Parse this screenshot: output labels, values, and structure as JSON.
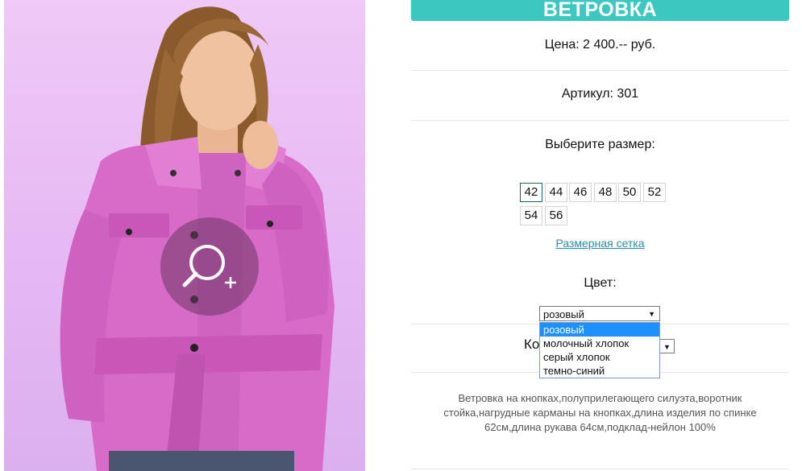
{
  "product": {
    "title": "ВЕТРОВКА",
    "price": "Цена: 2 400.-- руб.",
    "article": "Артикул: 301",
    "size_prompt": "Выберите размер:",
    "sizes": [
      "42",
      "44",
      "46",
      "48",
      "50",
      "52",
      "54",
      "56"
    ],
    "selected_size": "42",
    "size_chart_link": "Размерная сетка",
    "color_label": "Цвет:",
    "color_selected": "розовый",
    "color_options": [
      "розовый",
      "молочный хлопок",
      "серый хлопок",
      "темно-синий"
    ],
    "quantity_label_visible": "Ко",
    "description": "Ветровка на кнопках,полуприлегающего силуэта,воротник стойка,нагрудные карманы на кнопках,длина изделия по спинке 62см,длина рукава 64см,подклад-нейлон 100%"
  },
  "colors": {
    "accent": "#3cc8c0",
    "link": "#2b8fa4",
    "dropdown_highlight": "#1e90ff",
    "jacket": "#d86bc8"
  },
  "icons": {
    "zoom": "zoom-in-icon"
  }
}
